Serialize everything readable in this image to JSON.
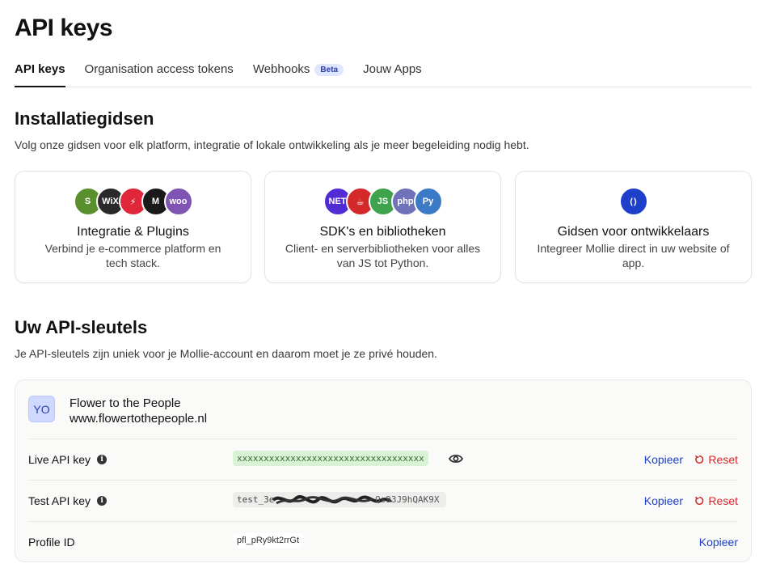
{
  "page_title": "API keys",
  "tabs": [
    {
      "label": "API keys",
      "active": true
    },
    {
      "label": "Organisation access tokens",
      "active": false
    },
    {
      "label": "Webhooks",
      "badge": "Beta",
      "active": false
    },
    {
      "label": "Jouw Apps",
      "active": false
    }
  ],
  "install": {
    "title": "Installatiegidsen",
    "desc": "Volg onze gidsen voor elk platform, integratie of lokale ontwikkeling als je meer begeleiding nodig hebt.",
    "cards": [
      {
        "title": "Integratie & Plugins",
        "desc": "Verbind je e-commerce platform en tech stack.",
        "logos": [
          {
            "name": "shopify",
            "text": "S",
            "color": "#5a8f2d"
          },
          {
            "name": "wix",
            "text": "WiX",
            "color": "#2a2a2a"
          },
          {
            "name": "lightspeed",
            "text": "⚡",
            "color": "#e0263a"
          },
          {
            "name": "magento",
            "text": "M",
            "color": "#1a1a1a"
          },
          {
            "name": "woocommerce",
            "text": "woo",
            "color": "#7f54b3"
          }
        ]
      },
      {
        "title": "SDK's en bibliotheken",
        "desc": "Client- en serverbibliotheken voor alles van JS tot Python.",
        "logos": [
          {
            "name": "dotnet",
            "text": "NET",
            "color": "#512bd4"
          },
          {
            "name": "java",
            "text": "☕",
            "color": "#d4282a"
          },
          {
            "name": "nodejs",
            "text": "JS",
            "color": "#3fa34d"
          },
          {
            "name": "php",
            "text": "php",
            "color": "#6f72b8"
          },
          {
            "name": "python",
            "text": "Py",
            "color": "#3a7ac7"
          }
        ]
      },
      {
        "title": "Gidsen voor ontwikkelaars",
        "desc": "Integreer Mollie direct in uw website of app.",
        "logos": [
          {
            "name": "developer-guide",
            "text": "⟨⟩",
            "color": "#1d3fc9"
          }
        ]
      }
    ]
  },
  "keys_section": {
    "title": "Uw API-sleutels",
    "desc": "Je API-sleutels zijn uniek voor je Mollie-account en daarom moet je ze privé houden.",
    "profile": {
      "initials": "YO",
      "name": "Flower to the People",
      "url": "www.flowertothepeople.nl"
    },
    "rows": [
      {
        "label": "Live API key",
        "value": "xxxxxxxxxxxxxxxxxxxxxxxxxxxxxxxxxxx",
        "copy": "Kopieer",
        "reset": "Reset"
      },
      {
        "label": "Test API key",
        "value": "test_3e",
        "value_tail": "Qs93J9hQAK9X",
        "copy": "Kopieer",
        "reset": "Reset"
      },
      {
        "label": "Profile ID",
        "value": "pfl_pRy9kt2rrGt",
        "copy": "Kopieer"
      }
    ]
  },
  "colors": {
    "accent": "#1d3fc9",
    "danger": "#d4282a",
    "live_key_bg": "#d9f2d6"
  }
}
